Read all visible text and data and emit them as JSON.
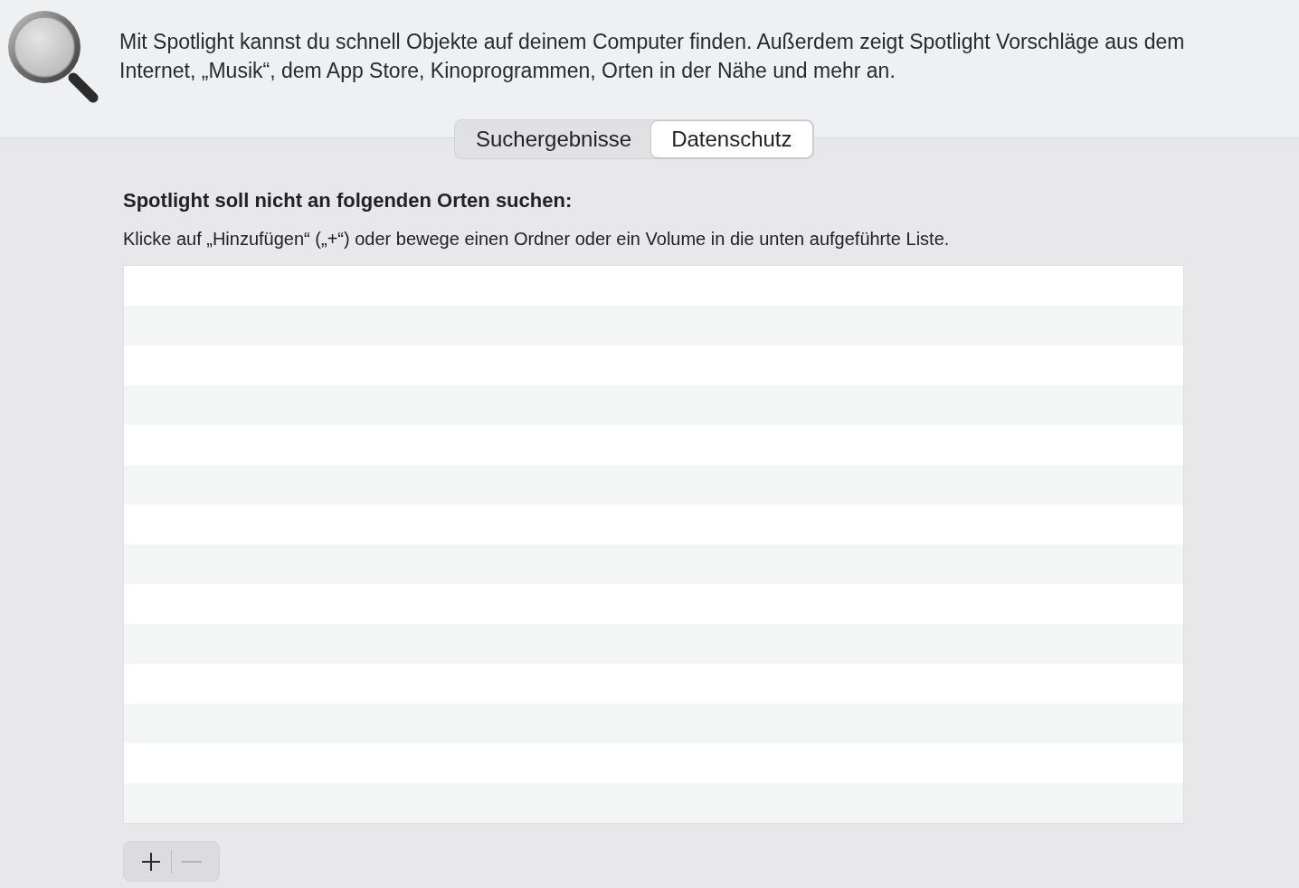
{
  "header": {
    "description": "Mit Spotlight kannst du schnell Objekte auf deinem Computer finden. Außerdem zeigt Spotlight Vorschläge aus dem Internet, „Musik“, dem App Store, Kinoprogrammen, Orten in der Nähe und mehr an."
  },
  "tabs": [
    {
      "label": "Suchergebnisse",
      "selected": false
    },
    {
      "label": "Datenschutz",
      "selected": true
    }
  ],
  "privacy": {
    "heading": "Spotlight soll nicht an folgenden Orten suchen:",
    "instructions": "Klicke auf „Hinzufügen“ („+“) oder bewege einen Ordner oder ein Volume in die unten aufgeführte Liste."
  },
  "list_buttons": [
    {
      "kind": "add",
      "disabled": false
    },
    {
      "kind": "remove",
      "disabled": true
    }
  ]
}
